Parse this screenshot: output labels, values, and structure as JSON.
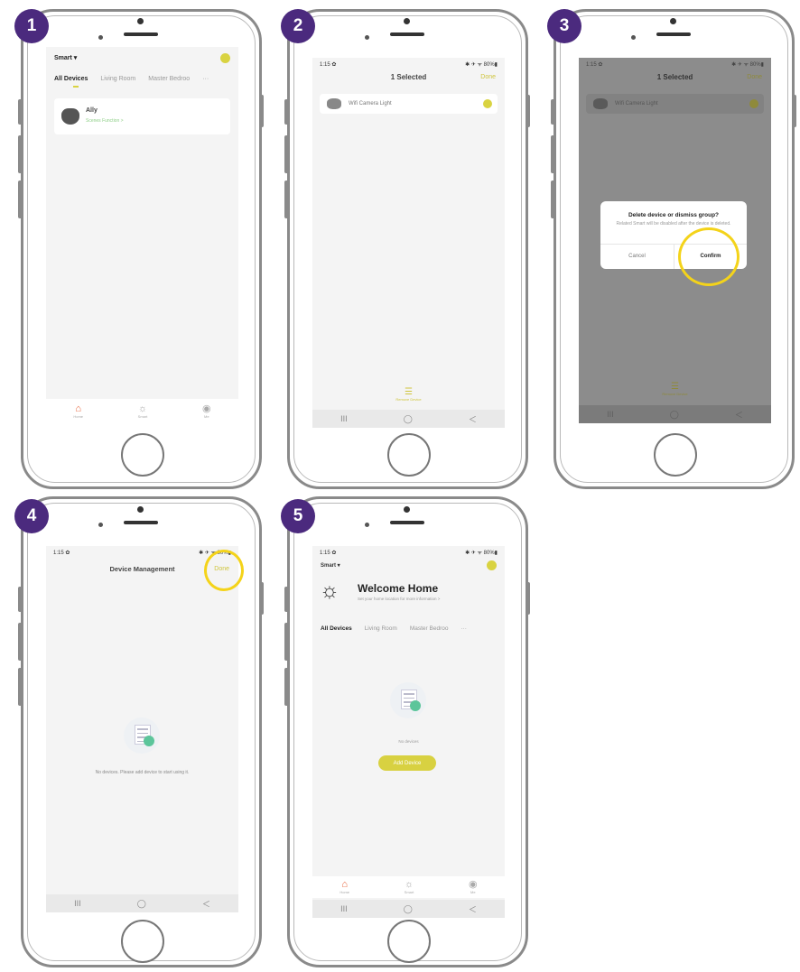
{
  "steps": [
    "1",
    "2",
    "3",
    "4",
    "5"
  ],
  "phone1": {
    "home_title": "Smart ▾",
    "tabs": [
      "All Devices",
      "Living Room",
      "Master Bedroo",
      "···"
    ],
    "device_name": "Ally",
    "device_sub": "Scenes Function >",
    "nav": [
      "Home",
      "Smart",
      "Me"
    ]
  },
  "phone2": {
    "status_left": "1:15 ✿",
    "status_right": "✱ ✈ ᯤ 80%▮",
    "title": "1 Selected",
    "done": "Done",
    "device_name": "Wifi Camera Light",
    "bottom_action": "Remove Device",
    "sys_keys": [
      "III",
      "◯",
      "＜"
    ]
  },
  "phone3": {
    "status_left": "1:15 ✿",
    "status_right": "✱ ✈ ᯤ 80%▮",
    "title": "1 Selected",
    "done": "Done",
    "device_name": "Wifi Camera Light",
    "dialog_title": "Delete device or dismiss group?",
    "dialog_body": "Related Smart will be disabled after the device is deleted.",
    "cancel": "Cancel",
    "confirm": "Confirm",
    "bottom_action": "Remove Device",
    "sys_keys": [
      "III",
      "◯",
      "＜"
    ]
  },
  "phone4": {
    "status_left": "1:15 ✿",
    "status_right": "✱ ✈ ᯤ 80%▮",
    "title": "Device Management",
    "done": "Done",
    "empty_text": "No devices. Please add device to start using it.",
    "sys_keys": [
      "III",
      "◯",
      "＜"
    ]
  },
  "phone5": {
    "status_left": "1:15 ✿",
    "status_right": "✱ ✈ ᯤ 80%▮",
    "home_title": "Smart ▾",
    "welcome": "Welcome Home",
    "welcome_sub": "Set your home location for more information >",
    "tabs": [
      "All Devices",
      "Living Room",
      "Master Bedroo",
      "···"
    ],
    "no_devices": "No devices",
    "add_device": "Add Device",
    "nav": [
      "Home",
      "Smart",
      "Me"
    ],
    "sys_keys": [
      "III",
      "◯",
      "＜"
    ]
  },
  "colors": {
    "badge": "#4b2a7e",
    "accent": "#d9d341",
    "highlight": "#f4d31a",
    "home_active": "#e8633a"
  }
}
